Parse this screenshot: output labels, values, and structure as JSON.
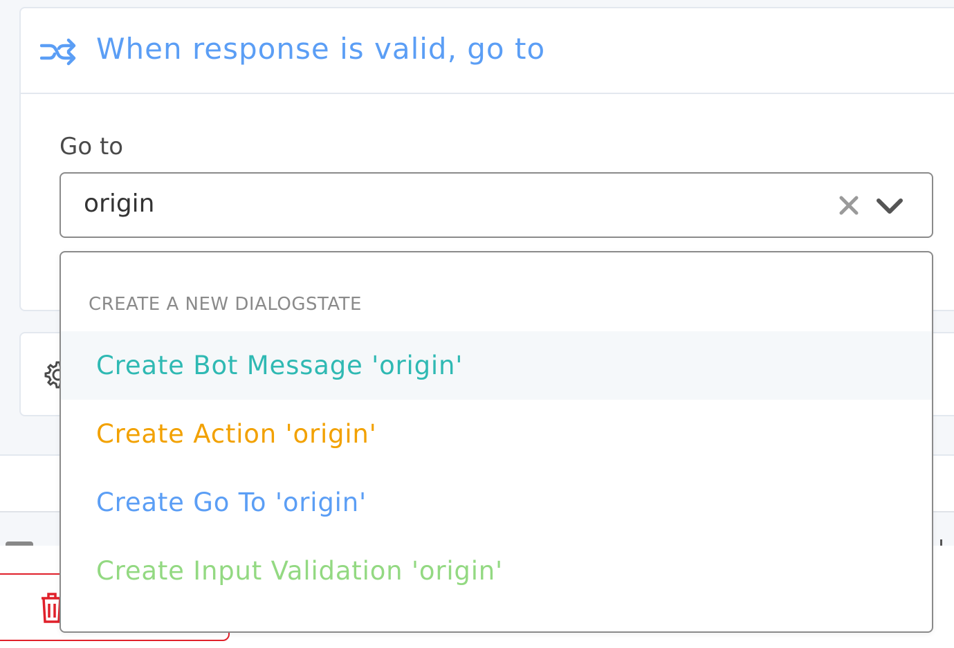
{
  "card": {
    "icon": "shuffle-arrows-icon",
    "title": "When response is valid, go to"
  },
  "goto_field": {
    "label": "Go to",
    "value": "origin",
    "clear_icon": "close-icon",
    "toggle_icon": "chevron-down-icon"
  },
  "dropdown": {
    "group_header": "CREATE A NEW DIALOGSTATE",
    "options": [
      {
        "label": "Create Bot Message 'origin'",
        "color": "#2fb9b3",
        "highlighted": true
      },
      {
        "label": "Create Action 'origin'",
        "color": "#f2a100",
        "highlighted": false
      },
      {
        "label": "Create Go To 'origin'",
        "color": "#5b9ef5",
        "highlighted": false
      },
      {
        "label": "Create Input Validation 'origin'",
        "color": "#93d982",
        "highlighted": false
      }
    ]
  },
  "settings_card": {
    "icon": "gear-icon"
  },
  "footer": {
    "delete_icon": "trash-icon"
  },
  "colors": {
    "accent_blue": "#5b9ef5",
    "danger_red": "#e0202a",
    "border": "#8a8a8a"
  }
}
